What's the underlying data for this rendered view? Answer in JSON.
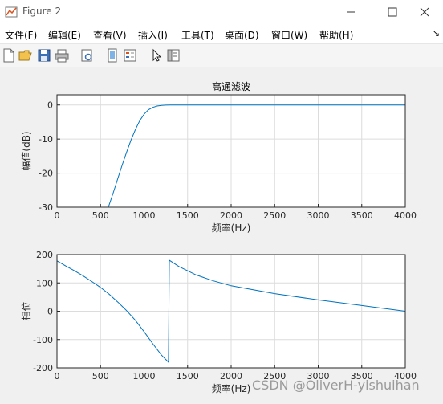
{
  "window": {
    "title": "Figure 2",
    "icon": "matlab-figure-icon",
    "controls": [
      "minimize-icon",
      "maximize-icon",
      "close-icon"
    ]
  },
  "menu": {
    "items": [
      "文件(F)",
      "编辑(E)",
      "查看(V)",
      "插入(I)",
      "工具(T)",
      "桌面(D)",
      "窗口(W)",
      "帮助(H)"
    ],
    "overflow_glyph": "↘"
  },
  "toolbar": {
    "icons": [
      "new-figure-icon",
      "open-file-icon",
      "save-icon",
      "print-icon",
      "print-preview-icon",
      "link-plot-icon",
      "insert-legend-icon",
      "pointer-icon",
      "property-editor-icon"
    ]
  },
  "chart_data": [
    {
      "type": "line",
      "title": "高通滤波",
      "xlabel": "频率(Hz)",
      "ylabel": "幅值(dB)",
      "xlim": [
        0,
        4000
      ],
      "ylim": [
        -30,
        3
      ],
      "xticks": [
        "0",
        "500",
        "1000",
        "1500",
        "2000",
        "2500",
        "3000",
        "3500",
        "4000"
      ],
      "yticks": [
        "0",
        "-10",
        "-20",
        "-30"
      ],
      "grid": true,
      "color": "#0072bd",
      "series": [
        {
          "x": [
            590,
            650,
            700,
            750,
            800,
            850,
            900,
            950,
            1000,
            1050,
            1100,
            1150,
            1200,
            1250,
            1300,
            1400,
            1600,
            2000,
            3000,
            4000
          ],
          "y": [
            -30,
            -25.5,
            -21.5,
            -17.5,
            -13.8,
            -10.3,
            -7.2,
            -4.6,
            -2.7,
            -1.4,
            -0.7,
            -0.3,
            -0.12,
            -0.04,
            0,
            0,
            0,
            0,
            0,
            0
          ]
        }
      ]
    },
    {
      "type": "line",
      "title": "",
      "xlabel": "频率(Hz)",
      "ylabel": "相位",
      "xlim": [
        0,
        4000
      ],
      "ylim": [
        -200,
        200
      ],
      "xticks": [
        "0",
        "500",
        "1000",
        "1500",
        "2000",
        "2500",
        "3000",
        "3500",
        "4000"
      ],
      "yticks": [
        "200",
        "100",
        "0",
        "-100",
        "-200"
      ],
      "grid": true,
      "color": "#0072bd",
      "series": [
        {
          "x": [
            0,
            100,
            200,
            300,
            400,
            500,
            600,
            700,
            800,
            900,
            1000,
            1100,
            1200,
            1280,
            1290,
            1400,
            1600,
            1800,
            2000,
            2500,
            3000,
            3500,
            4000
          ],
          "y": [
            178,
            160,
            143,
            125,
            105,
            84,
            60,
            32,
            2,
            -32,
            -72,
            -115,
            -155,
            -180,
            180,
            158,
            128,
            107,
            90,
            62,
            40,
            20,
            0
          ]
        }
      ]
    }
  ],
  "watermark": "CSDN @OliverH-yishuihan"
}
